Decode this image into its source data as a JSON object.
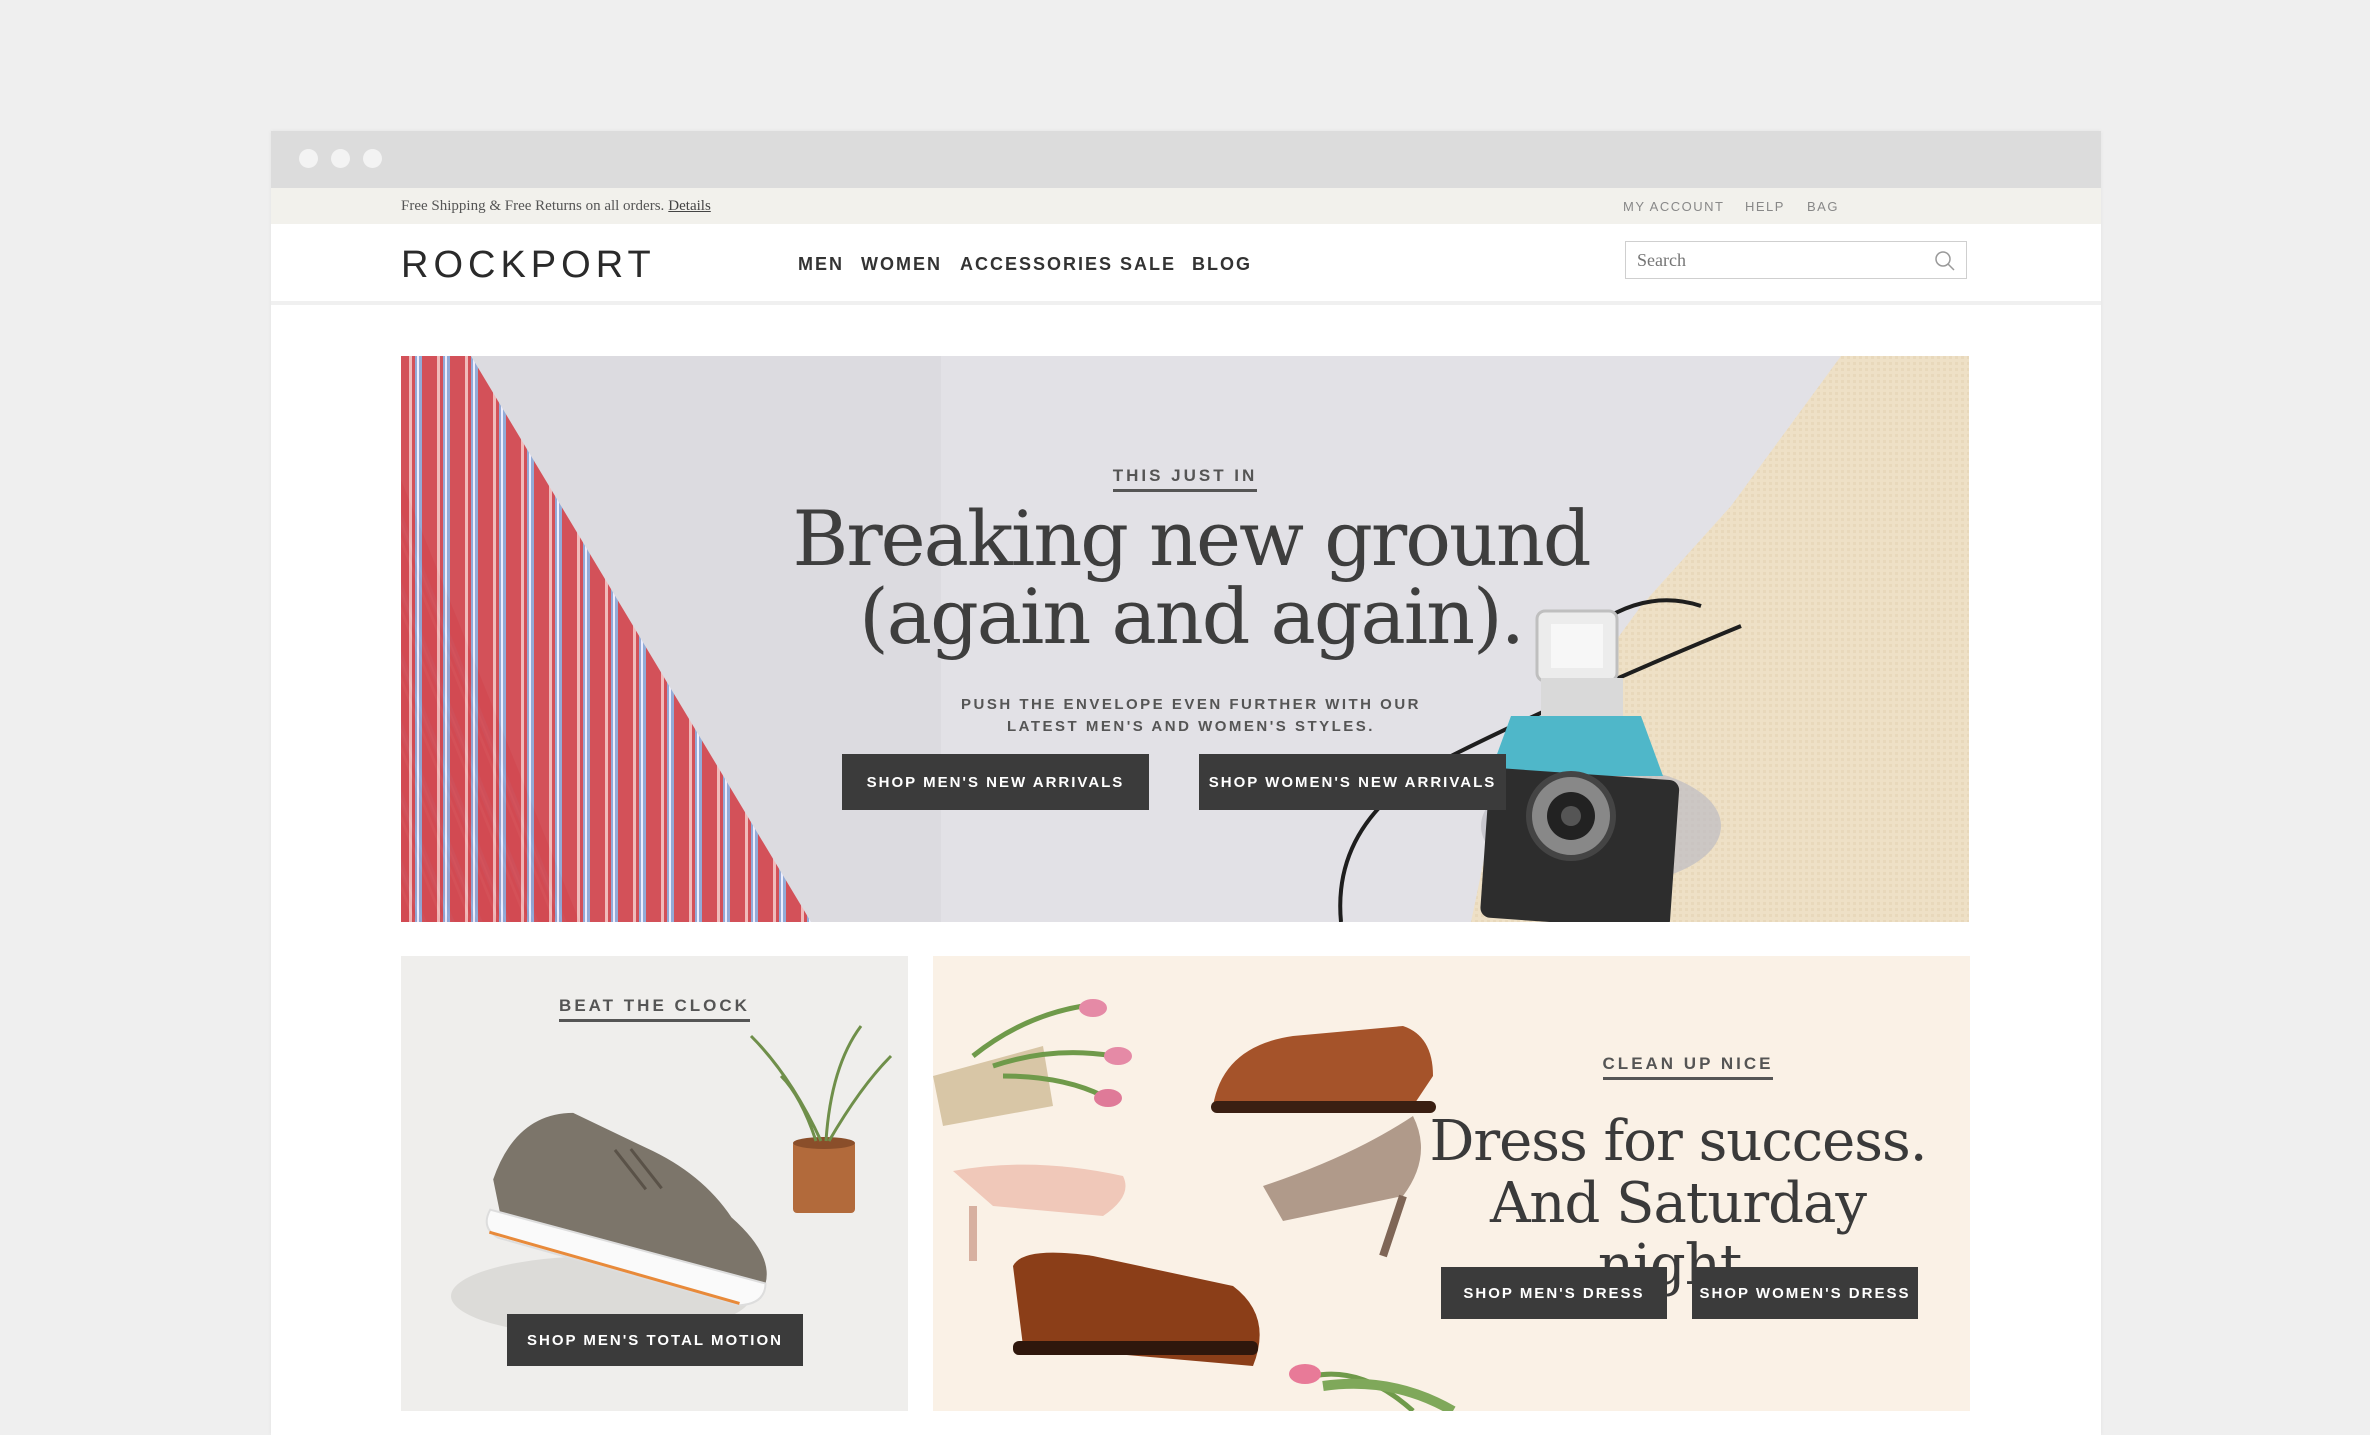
{
  "promo": {
    "text": "Free Shipping & Free Returns on all orders.",
    "link": "Details"
  },
  "utility_nav": [
    "MY ACCOUNT",
    "HELP",
    "BAG"
  ],
  "header": {
    "logo": "ROCKPORT",
    "nav": [
      "MEN",
      "WOMEN",
      "ACCESSORIES",
      "SALE",
      "BLOG"
    ],
    "search_placeholder": "Search"
  },
  "hero": {
    "eyebrow": "THIS JUST IN",
    "title_line1": "Breaking new ground",
    "title_line2": "(again and again).",
    "sub_line1": "PUSH THE ENVELOPE EVEN FURTHER WITH OUR",
    "sub_line2": "LATEST MEN'S AND WOMEN'S STYLES.",
    "btn_men": "SHOP MEN'S NEW ARRIVALS",
    "btn_women": "SHOP WOMEN'S NEW ARRIVALS"
  },
  "card_left": {
    "eyebrow": "BEAT THE CLOCK",
    "button": "SHOP MEN'S TOTAL MOTION"
  },
  "card_right": {
    "eyebrow": "CLEAN UP NICE",
    "title_line1": "Dress for success.",
    "title_line2": "And Saturday night.",
    "btn_men": "SHOP MEN'S DRESS",
    "btn_women": "SHOP WOMEN'S DRESS"
  },
  "colors": {
    "page_bg": "#efefef",
    "chrome": "#dcdcdc",
    "promo_bar": "#f2f1ec",
    "button": "#3b3b3b",
    "hero_bg": "#dcdbe0",
    "card_left_bg": "#efeeec",
    "card_right_bg": "#faf1e6"
  }
}
